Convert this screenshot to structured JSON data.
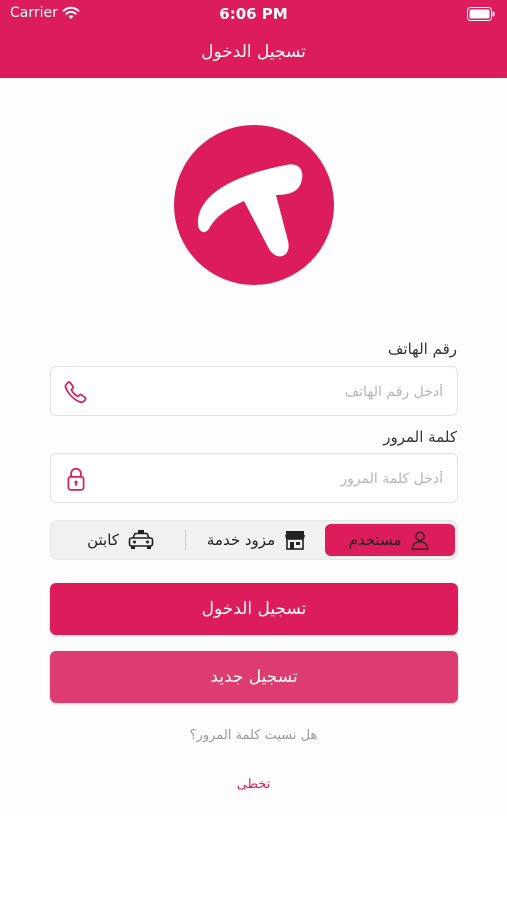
{
  "status_bar": {
    "carrier": "Carrier",
    "time": "6:06 PM",
    "wifi_icon": "wifi-icon",
    "battery_icon": "battery-icon"
  },
  "nav": {
    "title": "تسجيل الدخول"
  },
  "logo": {
    "icon": "t-letter-logo",
    "color": "#dd1c5b"
  },
  "form": {
    "phone": {
      "label": "رقم الهاتف",
      "placeholder": "أدخل رقم الهاتف",
      "value": "",
      "icon": "phone-icon"
    },
    "password": {
      "label": "كلمة المرور",
      "placeholder": "أدخل كلمة المرور",
      "value": "",
      "icon": "lock-icon"
    }
  },
  "user_type": {
    "selected": "مستخدم",
    "options": [
      {
        "label": "مستخدم",
        "icon": "person-icon"
      },
      {
        "label": "مزود خدمة",
        "icon": "store-icon"
      },
      {
        "label": "كابتن",
        "icon": "taxi-icon"
      }
    ]
  },
  "buttons": {
    "login": "تسجيل الدخول",
    "register": "تسجيل جديد"
  },
  "links": {
    "forgot_password": "هل نسيت كلمة المرور؟",
    "skip": "تخطى"
  },
  "colors": {
    "brand": "#dd1c5b",
    "register_button": "#dc3c70"
  }
}
